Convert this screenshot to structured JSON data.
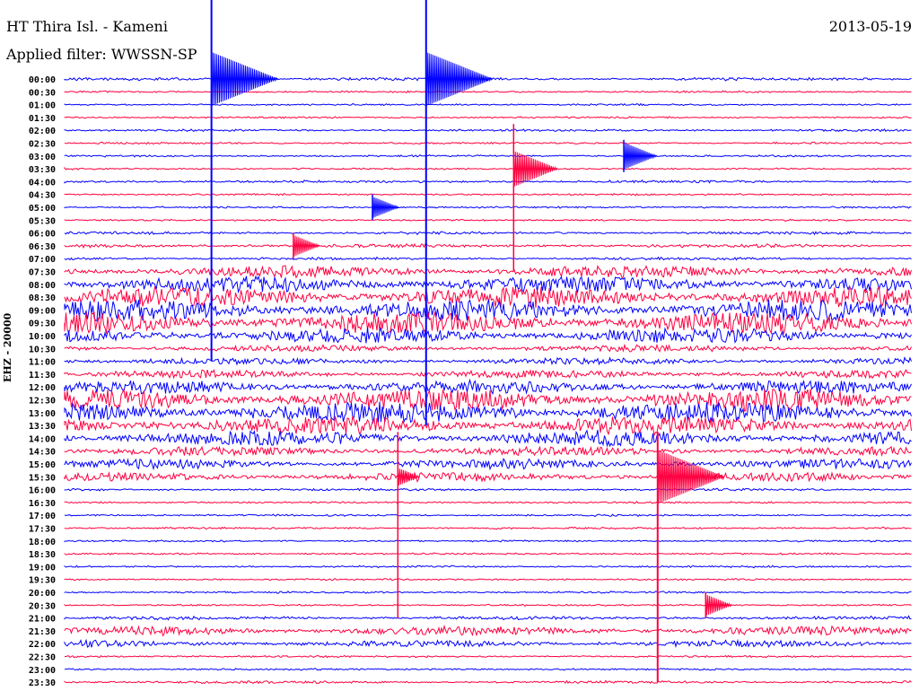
{
  "header": {
    "station": "HT Thira Isl. - Kameni",
    "filter": "Applied filter: WWSSN-SP",
    "date": "2013-05-19"
  },
  "chart_data": {
    "type": "line",
    "title": "HT Thira Isl. - Kameni",
    "ylabel": "EHZ - 20000",
    "xrange_minutes": [
      0,
      30
    ],
    "colors": {
      "even": "#0000ff",
      "odd": "#ff0040"
    },
    "traces": [
      {
        "label": "00:00",
        "noise": 0.12
      },
      {
        "label": "00:30",
        "noise": 0.05
      },
      {
        "label": "01:00",
        "noise": 0.05
      },
      {
        "label": "01:30",
        "noise": 0.05
      },
      {
        "label": "02:00",
        "noise": 0.08
      },
      {
        "label": "02:30",
        "noise": 0.06
      },
      {
        "label": "03:00",
        "noise": 0.06
      },
      {
        "label": "03:30",
        "noise": 0.05
      },
      {
        "label": "04:00",
        "noise": 0.1
      },
      {
        "label": "04:30",
        "noise": 0.06
      },
      {
        "label": "05:00",
        "noise": 0.05
      },
      {
        "label": "05:30",
        "noise": 0.05
      },
      {
        "label": "06:00",
        "noise": 0.1
      },
      {
        "label": "06:30",
        "noise": 0.15
      },
      {
        "label": "07:00",
        "noise": 0.1
      },
      {
        "label": "07:30",
        "noise": 0.55
      },
      {
        "label": "08:00",
        "noise": 0.75
      },
      {
        "label": "08:30",
        "noise": 0.95
      },
      {
        "label": "09:00",
        "noise": 1.0
      },
      {
        "label": "09:30",
        "noise": 1.0
      },
      {
        "label": "10:00",
        "noise": 0.7
      },
      {
        "label": "10:30",
        "noise": 0.3
      },
      {
        "label": "11:00",
        "noise": 0.3
      },
      {
        "label": "11:30",
        "noise": 0.35
      },
      {
        "label": "12:00",
        "noise": 0.6
      },
      {
        "label": "12:30",
        "noise": 1.0
      },
      {
        "label": "13:00",
        "noise": 1.0
      },
      {
        "label": "13:30",
        "noise": 0.85
      },
      {
        "label": "14:00",
        "noise": 0.7
      },
      {
        "label": "14:30",
        "noise": 0.4
      },
      {
        "label": "15:00",
        "noise": 0.45
      },
      {
        "label": "15:30",
        "noise": 0.4
      },
      {
        "label": "16:00",
        "noise": 0.08
      },
      {
        "label": "16:30",
        "noise": 0.05
      },
      {
        "label": "17:00",
        "noise": 0.06
      },
      {
        "label": "17:30",
        "noise": 0.06
      },
      {
        "label": "18:00",
        "noise": 0.05
      },
      {
        "label": "18:30",
        "noise": 0.05
      },
      {
        "label": "19:00",
        "noise": 0.06
      },
      {
        "label": "19:30",
        "noise": 0.05
      },
      {
        "label": "20:00",
        "noise": 0.06
      },
      {
        "label": "20:30",
        "noise": 0.05
      },
      {
        "label": "21:00",
        "noise": 0.15
      },
      {
        "label": "21:30",
        "noise": 0.4
      },
      {
        "label": "22:00",
        "noise": 0.3
      },
      {
        "label": "22:30",
        "noise": 0.06
      },
      {
        "label": "23:00",
        "noise": 0.06
      },
      {
        "label": "23:30",
        "noise": 0.1
      }
    ],
    "events": [
      {
        "trace": 0,
        "minute": 5.2,
        "rows_spanned": 22,
        "amp": 3
      },
      {
        "trace": 0,
        "minute": 12.8,
        "rows_spanned": 27,
        "amp": 3
      },
      {
        "trace": 7,
        "minute": 15.9,
        "rows_spanned": 8,
        "amp": 2
      },
      {
        "trace": 31,
        "minute": 21.0,
        "rows_spanned": 16,
        "amp": 3
      },
      {
        "trace": 31,
        "minute": 11.8,
        "rows_spanned": 11,
        "amp": 1
      },
      {
        "trace": 6,
        "minute": 19.8,
        "rows_spanned": 1,
        "amp": 1.5
      },
      {
        "trace": 10,
        "minute": 10.9,
        "rows_spanned": 1,
        "amp": 1.2
      },
      {
        "trace": 13,
        "minute": 8.1,
        "rows_spanned": 1,
        "amp": 1.2
      },
      {
        "trace": 41,
        "minute": 22.7,
        "rows_spanned": 1,
        "amp": 1.2
      }
    ]
  }
}
